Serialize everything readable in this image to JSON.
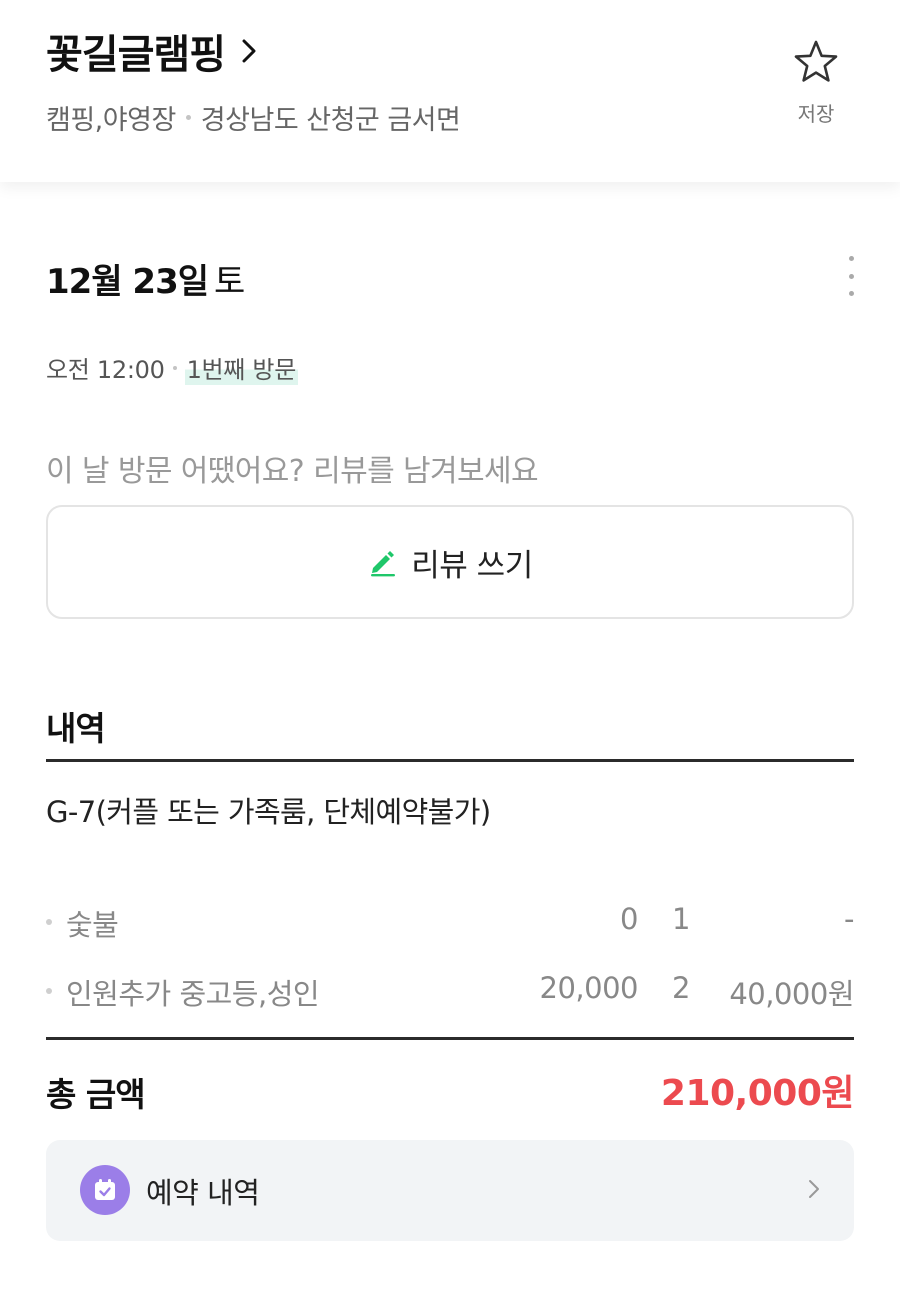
{
  "header": {
    "place_name": "꽃길글램핑",
    "category": "캠핑,야영장",
    "address": "경상남도 산청군 금서면",
    "save_label": "저장"
  },
  "visit": {
    "date": "12월 23일",
    "weekday": "토",
    "time": "오전 12:00",
    "visit_count": "1번째 방문"
  },
  "review": {
    "prompt": "이 날 방문 어땠어요? 리뷰를 남겨보세요",
    "button_label": "리뷰 쓰기"
  },
  "details": {
    "title": "내역",
    "item_name": "G-7(커플 또는 가족룸, 단체예약불가)",
    "lines": [
      {
        "name": "숯불",
        "price": "0",
        "qty": "1",
        "amount": "-"
      },
      {
        "name": "인원추가 중고등,성인",
        "price": "20,000",
        "qty": "2",
        "amount": "40,000원"
      }
    ],
    "total_label": "총 금액",
    "total_value": "210,000원"
  },
  "booking": {
    "label": "예약 내역"
  },
  "colors": {
    "accent_red": "#ec4a4f",
    "pencil_green": "#1fc76a",
    "calendar_purple": "#9b7ee8"
  },
  "icons": [
    "chevron-right-icon",
    "star-icon",
    "more-vertical-icon",
    "pencil-icon",
    "calendar-check-icon"
  ]
}
